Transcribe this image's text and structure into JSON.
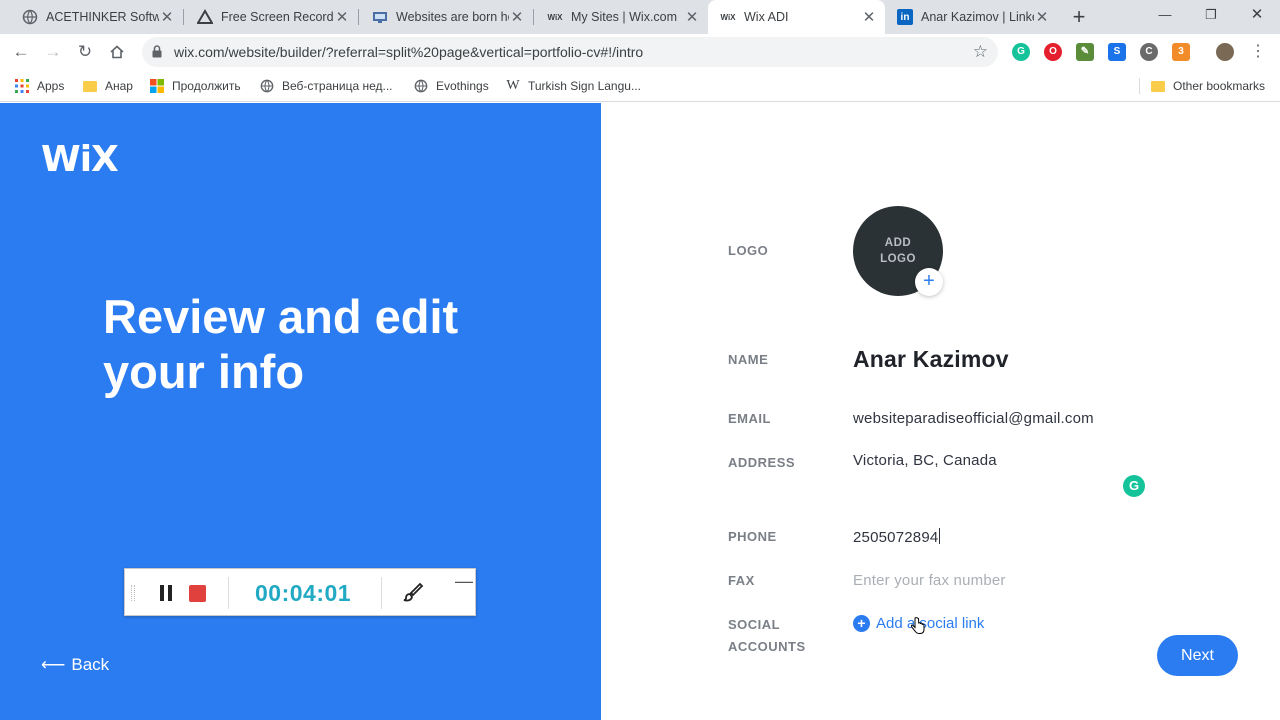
{
  "browser": {
    "tabs": [
      {
        "title": "ACETHINKER Softwa",
        "icon": "globe-icon"
      },
      {
        "title": "Free Screen Recorde",
        "icon": "acethinker-icon"
      },
      {
        "title": "Websites are born he",
        "icon": "monitor-icon"
      },
      {
        "title": "My Sites | Wix.com",
        "icon": "wix-icon",
        "icon_text": "WiX"
      },
      {
        "title": "Wix ADI",
        "icon": "wix-icon",
        "icon_text": "WiX"
      },
      {
        "title": "Anar Kazimov | Linke",
        "icon": "linkedin-icon",
        "icon_text": "in"
      }
    ],
    "new_tab": "+",
    "url": "wix.com/website/builder/?referral=split%20page&vertical=portfolio-cv#!/intro",
    "extensions": [
      {
        "name": "grammarly",
        "color": "#15c39a",
        "glyph": "G"
      },
      {
        "name": "adblock",
        "color": "#e4202e",
        "glyph": "O"
      },
      {
        "name": "eyedropper",
        "color": "#5b8c3a",
        "glyph": "✎"
      },
      {
        "name": "screen-share",
        "color": "#1a73e8",
        "glyph": "S"
      },
      {
        "name": "c-ext",
        "color": "#6a6a6a",
        "glyph": "C"
      },
      {
        "name": "orange-ext",
        "color": "#f28c28",
        "glyph": "3"
      }
    ],
    "bookmarks": [
      {
        "label": "Apps",
        "icon": "apps-grid-icon"
      },
      {
        "label": "Анар",
        "icon": "folder-icon"
      },
      {
        "label": "Продолжить",
        "icon": "microsoft-icon"
      },
      {
        "label": "Веб-страница нед...",
        "icon": "globe-icon"
      },
      {
        "label": "Evothings",
        "icon": "globe-icon"
      },
      {
        "label": "Turkish Sign Langu...",
        "icon": "wikipedia-icon",
        "icon_text": "W"
      }
    ],
    "other_bookmarks": "Other bookmarks"
  },
  "left": {
    "brand": "WiX",
    "heading": "Review and edit your info",
    "back_label": "Back",
    "back_arrow": "⟵",
    "color": "#2b7cf0"
  },
  "recorder": {
    "timer": "00:04:01",
    "minimize": "—"
  },
  "form": {
    "logo_label": "LOGO",
    "logo_button": [
      "ADD",
      "LOGO"
    ],
    "logo_plus": "+",
    "name_label": "NAME",
    "name_value": "Anar Kazimov",
    "email_label": "EMAIL",
    "email_value": "websiteparadiseofficial@gmail.com",
    "address_label": "ADDRESS",
    "address_value": "Victoria, BC, Canada",
    "phone_label": "PHONE",
    "phone_value": "2505072894",
    "fax_label": "FAX",
    "fax_placeholder": "Enter your fax number",
    "social_label": [
      "SOCIAL",
      "ACCOUNTS"
    ],
    "add_social": "Add a social link",
    "next_button": "Next"
  }
}
